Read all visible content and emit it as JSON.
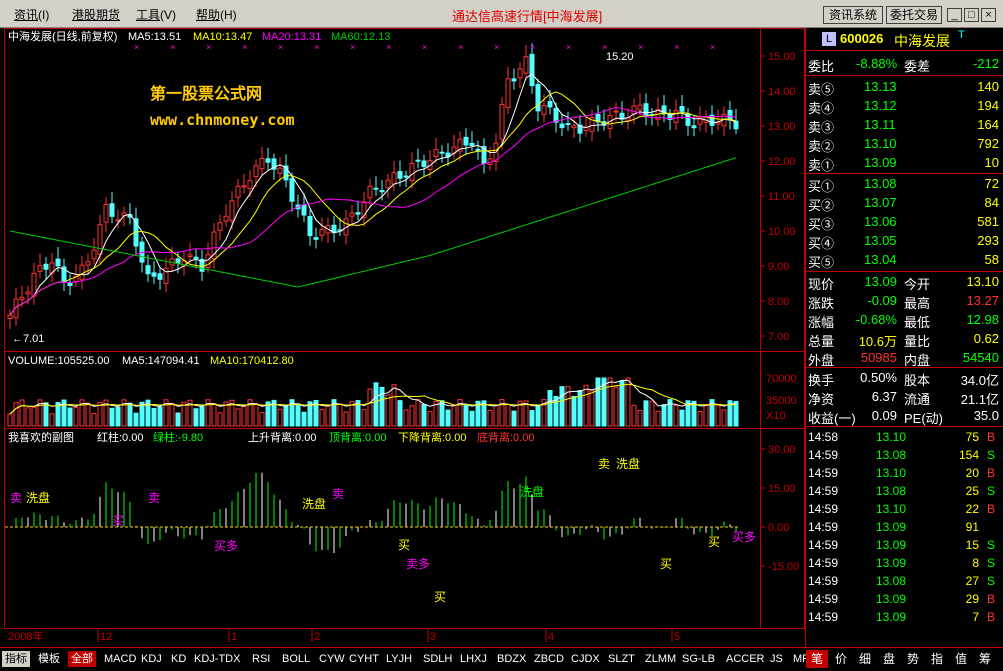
{
  "menu": [
    {
      "label": "资讯",
      "key": "(I)"
    },
    {
      "label": "港股期货",
      "key": ""
    },
    {
      "label": "工具",
      "key": "(V)"
    },
    {
      "label": "帮助",
      "key": "(H)"
    }
  ],
  "window": {
    "title": "通达信高速行情",
    "title_suffix": "[中海发展]",
    "btn_info": "资讯系统",
    "btn_trade": "委托交易"
  },
  "chart": {
    "header": "中海发展(日线,前复权)",
    "ma5": "MA5:13.51",
    "ma10": "MA10:13.47",
    "ma20": "MA20:13.31",
    "ma60": "MA60:12.13",
    "watermark1": "第一股票公式网",
    "watermark2": "www.chnmoney.com",
    "price_ticks": [
      "15.00",
      "14.00",
      "13.00",
      "12.00",
      "11.00",
      "10.00",
      "9.00",
      "8.00",
      "7.00"
    ],
    "high_label": "15.20",
    "low_label": "←7.01",
    "volume_header": "VOLUME:105525.00",
    "vma5": "MA5:147094.41",
    "vma10": "MA10:170412.80",
    "vol_ticks": [
      "70000",
      "35000",
      "X10"
    ],
    "sub_title": "我喜欢的副图",
    "red_bar": "红柱:0.00",
    "green_bar": "绿柱:-9.80",
    "up_div": "上升背离:0.00",
    "top_div": "顶背离:0.00",
    "down_div": "下降背离:0.00",
    "bottom_div": "底背离:0.00",
    "sub_ticks": [
      "30.00",
      "15.00",
      "0.00",
      "-15.00"
    ],
    "time_labels": [
      "2008年",
      "12",
      "1",
      "2",
      "3",
      "4",
      "5"
    ],
    "annotations": [
      "卖",
      "洗盘",
      "买",
      "卖",
      "洗盘",
      "买多",
      "买",
      "卖多",
      "买",
      "洗盘",
      "卖",
      "洗盘",
      "买",
      "卖",
      "买",
      "买多"
    ],
    "colors": {
      "ma5": "#ffffff",
      "ma10": "#ffff00",
      "ma20": "#ff00ff",
      "ma60": "#00cc00",
      "up": "#ff3232",
      "down": "#54ffff",
      "grid": "#c00000"
    }
  },
  "quote": {
    "code": "600026",
    "name": "中海发展",
    "tag": "T",
    "ratio_label": "委比",
    "ratio_value": "-8.88%",
    "diff_label": "委差",
    "diff_value": "-212",
    "asks": [
      {
        "label": "卖⑤",
        "price": "13.13",
        "vol": "140"
      },
      {
        "label": "卖④",
        "price": "13.12",
        "vol": "194"
      },
      {
        "label": "卖③",
        "price": "13.11",
        "vol": "164"
      },
      {
        "label": "卖②",
        "price": "13.10",
        "vol": "792"
      },
      {
        "label": "卖①",
        "price": "13.09",
        "vol": "10"
      }
    ],
    "bids": [
      {
        "label": "买①",
        "price": "13.08",
        "vol": "72"
      },
      {
        "label": "买②",
        "price": "13.07",
        "vol": "84"
      },
      {
        "label": "买③",
        "price": "13.06",
        "vol": "581"
      },
      {
        "label": "买④",
        "price": "13.05",
        "vol": "293"
      },
      {
        "label": "买⑤",
        "price": "13.04",
        "vol": "58"
      }
    ],
    "stats": [
      {
        "l1": "现价",
        "v1": "13.09",
        "l2": "今开",
        "v2": "13.10"
      },
      {
        "l1": "涨跌",
        "v1": "-0.09",
        "l2": "最高",
        "v2": "13.27"
      },
      {
        "l1": "涨幅",
        "v1": "-0.68%",
        "l2": "最低",
        "v2": "12.98"
      },
      {
        "l1": "总量",
        "v1": "10.6万",
        "l2": "量比",
        "v2": "0.62"
      },
      {
        "l1": "外盘",
        "v1": "50985",
        "l2": "内盘",
        "v2": "54540"
      }
    ],
    "stats2": [
      {
        "l1": "换手",
        "v1": "0.50%",
        "l2": "股本",
        "v2": "34.0亿"
      },
      {
        "l1": "净资",
        "v1": "6.37",
        "l2": "流通",
        "v2": "21.1亿"
      },
      {
        "l1": "收益(一)",
        "v1": "0.09",
        "l2": "PE(动)",
        "v2": "35.0"
      }
    ],
    "ticks": [
      {
        "t": "14:58",
        "p": "13.10",
        "v": "75",
        "s": "B"
      },
      {
        "t": "14:59",
        "p": "13.08",
        "v": "154",
        "s": "S"
      },
      {
        "t": "14:59",
        "p": "13.10",
        "v": "20",
        "s": "B"
      },
      {
        "t": "14:59",
        "p": "13.08",
        "v": "25",
        "s": "S"
      },
      {
        "t": "14:59",
        "p": "13.10",
        "v": "22",
        "s": "B"
      },
      {
        "t": "14:59",
        "p": "13.09",
        "v": "91",
        "s": ""
      },
      {
        "t": "14:59",
        "p": "13.09",
        "v": "15",
        "s": "S"
      },
      {
        "t": "14:59",
        "p": "13.09",
        "v": "8",
        "s": "S"
      },
      {
        "t": "14:59",
        "p": "13.08",
        "v": "27",
        "s": "S"
      },
      {
        "t": "14:59",
        "p": "13.09",
        "v": "29",
        "s": "B"
      },
      {
        "t": "14:59",
        "p": "13.09",
        "v": "7",
        "s": "B"
      }
    ]
  },
  "bottom_tabs": [
    "指标",
    "模板",
    "全部",
    "MACD",
    "KDJ",
    "KD",
    "KDJ-TDX",
    "RSI",
    "BOLL",
    "CYW",
    "CYHT",
    "LYJH",
    "SDLH",
    "LHXJ",
    "BDZX",
    "ZBCD",
    "CJDX",
    "SLZT",
    "ZLMM",
    "SG-LB",
    "ACCER",
    "JS",
    "MFI"
  ],
  "right_tabs": [
    "笔",
    "价",
    "细",
    "盘",
    "势",
    "指",
    "值",
    "筹"
  ]
}
